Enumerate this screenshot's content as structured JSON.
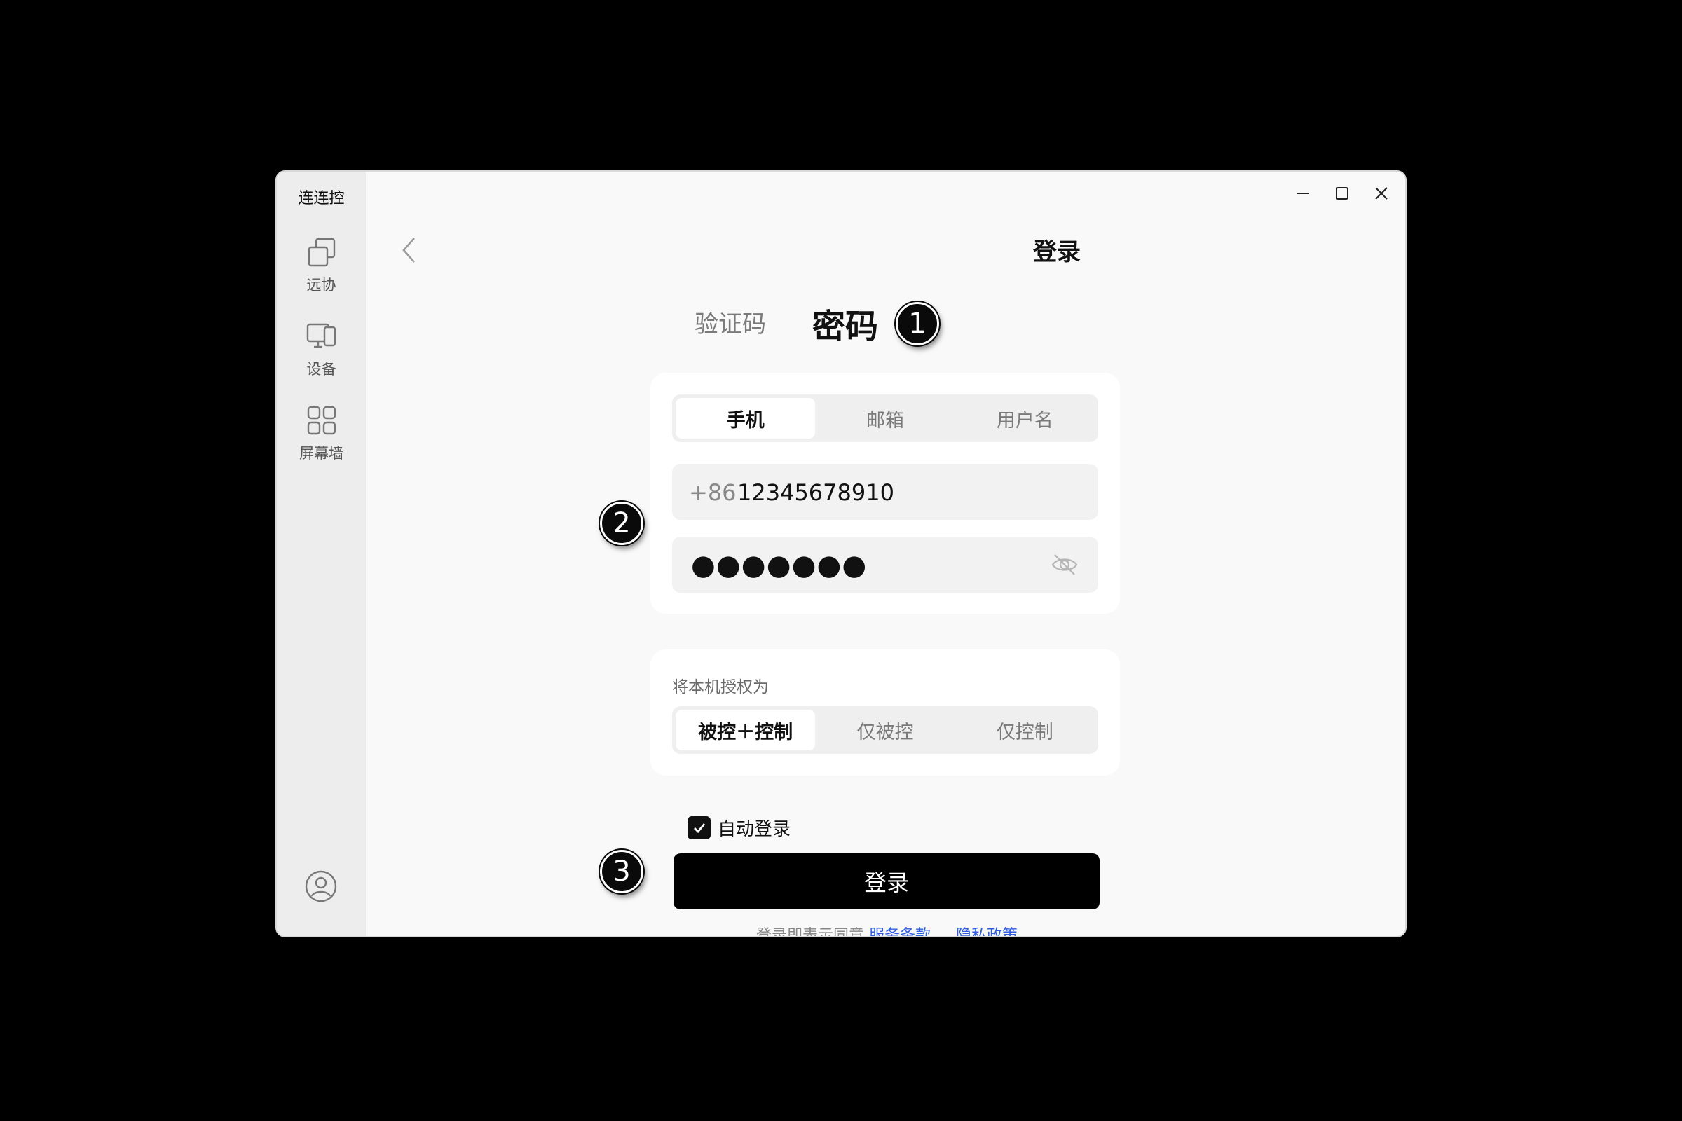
{
  "app": {
    "title": "连连控"
  },
  "sidebar": {
    "items": [
      {
        "label": "远协",
        "icon": "remote-assist-icon"
      },
      {
        "label": "设备",
        "icon": "devices-icon"
      },
      {
        "label": "屏幕墙",
        "icon": "screen-wall-icon"
      }
    ],
    "account_icon": "user-avatar-icon"
  },
  "window_controls": [
    "minimize-icon",
    "maximize-icon",
    "close-icon"
  ],
  "page": {
    "title": "登录",
    "back_icon": "chevron-left-icon"
  },
  "login_mode_tabs": {
    "code": "验证码",
    "password": "密码",
    "active": "password"
  },
  "account_type_tabs": {
    "items": [
      "手机",
      "邮箱",
      "用户名"
    ],
    "active": 0
  },
  "form": {
    "phone_prefix": "+86",
    "phone_value": "12345678910",
    "password_masked": "●●●●●●●",
    "visibility_icon": "eye-off-icon"
  },
  "authorize": {
    "label": "将本机授权为",
    "options": [
      "被控＋控制",
      "仅被控",
      "仅控制"
    ],
    "active": 0
  },
  "auto_login": {
    "label": "自动登录",
    "checked": true
  },
  "submit": {
    "label": "登录"
  },
  "agreement": {
    "prefix": "登录即表示同意",
    "terms": "服务条款",
    "separator": "、",
    "privacy": "隐私政策"
  },
  "annotations": [
    "1",
    "2",
    "3"
  ],
  "colors": {
    "background": "#000000",
    "window": "#f9f9f9",
    "sidebar": "#ededed",
    "primary_button": "#000000",
    "link": "#2f5ce0"
  }
}
